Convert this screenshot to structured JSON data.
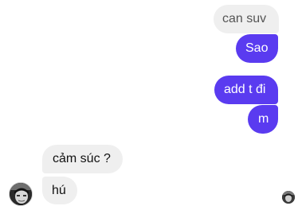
{
  "conversation": {
    "messages": [
      {
        "sender": "me",
        "text": "can suv"
      },
      {
        "sender": "me",
        "text": "Sao"
      },
      {
        "sender": "me",
        "text": "add t đi"
      },
      {
        "sender": "me",
        "text": "m"
      },
      {
        "sender": "them",
        "text": "cảm súc ?"
      },
      {
        "sender": "them",
        "text": "hú"
      }
    ]
  },
  "colors": {
    "outgoing_bubble": "#5a3bf0",
    "incoming_bubble": "#efefef"
  }
}
